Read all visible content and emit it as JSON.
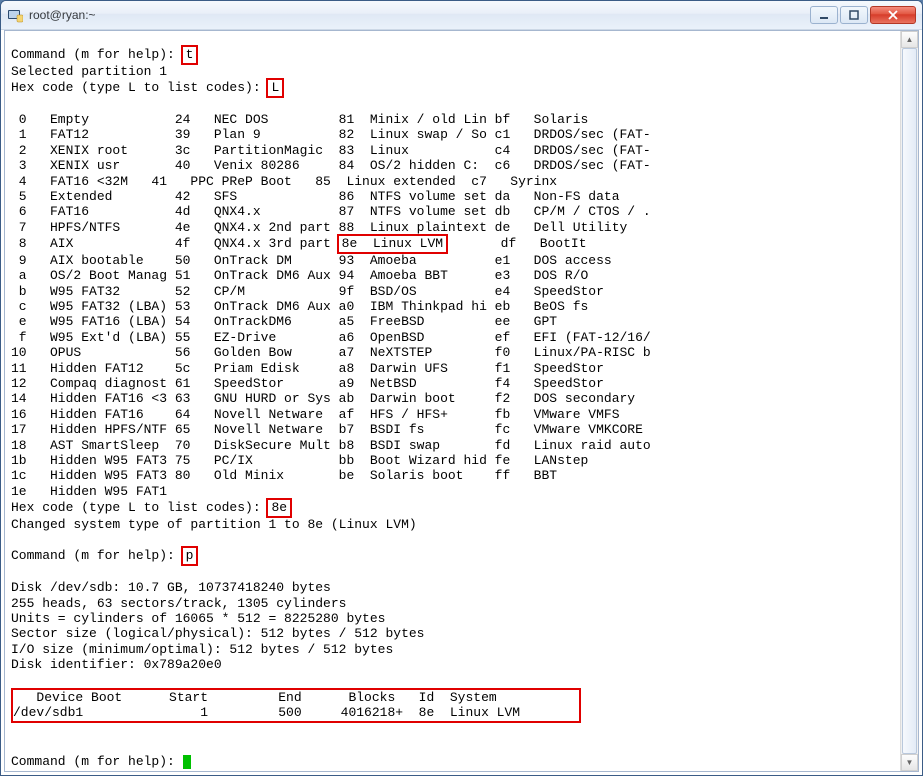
{
  "window": {
    "title": "root@ryan:~"
  },
  "prompts": {
    "cmd_prompt": "Command (m for help): ",
    "hex_prompt": "Hex code (type L to list codes): ",
    "selected_partition": "Selected partition 1",
    "changed_line": "Changed system type of partition 1 to 8e (Linux LVM)"
  },
  "inputs": {
    "t": "t",
    "L": "L",
    "eightE": "8e",
    "p": "p"
  },
  "partition_types": [
    [
      " 0",
      "Empty",
      "24",
      "NEC DOS",
      "81",
      "Minix / old Lin",
      "bf",
      "Solaris"
    ],
    [
      " 1",
      "FAT12",
      "39",
      "Plan 9",
      "82",
      "Linux swap / So",
      "c1",
      "DRDOS/sec (FAT-"
    ],
    [
      " 2",
      "XENIX root",
      "3c",
      "PartitionMagic",
      "83",
      "Linux",
      "c4",
      "DRDOS/sec (FAT-"
    ],
    [
      " 3",
      "XENIX usr",
      "40",
      "Venix 80286",
      "84",
      "OS/2 hidden C:",
      "c6",
      "DRDOS/sec (FAT-"
    ],
    [
      " 4",
      "FAT16 <32M",
      "41",
      "PPC PReP Boot",
      "85",
      "Linux extended",
      "c7",
      "Syrinx"
    ],
    [
      " 5",
      "Extended",
      "42",
      "SFS",
      "86",
      "NTFS volume set",
      "da",
      "Non-FS data"
    ],
    [
      " 6",
      "FAT16",
      "4d",
      "QNX4.x",
      "87",
      "NTFS volume set",
      "db",
      "CP/M / CTOS / ."
    ],
    [
      " 7",
      "HPFS/NTFS",
      "4e",
      "QNX4.x 2nd part",
      "88",
      "Linux plaintext",
      "de",
      "Dell Utility"
    ],
    [
      " 8",
      "AIX",
      "4f",
      "QNX4.x 3rd part",
      "8e",
      "Linux LVM",
      "df",
      "BootIt"
    ],
    [
      " 9",
      "AIX bootable",
      "50",
      "OnTrack DM",
      "93",
      "Amoeba",
      "e1",
      "DOS access"
    ],
    [
      " a",
      "OS/2 Boot Manag",
      "51",
      "OnTrack DM6 Aux",
      "94",
      "Amoeba BBT",
      "e3",
      "DOS R/O"
    ],
    [
      " b",
      "W95 FAT32",
      "52",
      "CP/M",
      "9f",
      "BSD/OS",
      "e4",
      "SpeedStor"
    ],
    [
      " c",
      "W95 FAT32 (LBA)",
      "53",
      "OnTrack DM6 Aux",
      "a0",
      "IBM Thinkpad hi",
      "eb",
      "BeOS fs"
    ],
    [
      " e",
      "W95 FAT16 (LBA)",
      "54",
      "OnTrackDM6",
      "a5",
      "FreeBSD",
      "ee",
      "GPT"
    ],
    [
      " f",
      "W95 Ext'd (LBA)",
      "55",
      "EZ-Drive",
      "a6",
      "OpenBSD",
      "ef",
      "EFI (FAT-12/16/"
    ],
    [
      "10",
      "OPUS",
      "56",
      "Golden Bow",
      "a7",
      "NeXTSTEP",
      "f0",
      "Linux/PA-RISC b"
    ],
    [
      "11",
      "Hidden FAT12",
      "5c",
      "Priam Edisk",
      "a8",
      "Darwin UFS",
      "f1",
      "SpeedStor"
    ],
    [
      "12",
      "Compaq diagnost",
      "61",
      "SpeedStor",
      "a9",
      "NetBSD",
      "f4",
      "SpeedStor"
    ],
    [
      "14",
      "Hidden FAT16 <3",
      "63",
      "GNU HURD or Sys",
      "ab",
      "Darwin boot",
      "f2",
      "DOS secondary"
    ],
    [
      "16",
      "Hidden FAT16",
      "64",
      "Novell Netware",
      "af",
      "HFS / HFS+",
      "fb",
      "VMware VMFS"
    ],
    [
      "17",
      "Hidden HPFS/NTF",
      "65",
      "Novell Netware",
      "b7",
      "BSDI fs",
      "fc",
      "VMware VMKCORE"
    ],
    [
      "18",
      "AST SmartSleep",
      "70",
      "DiskSecure Mult",
      "b8",
      "BSDI swap",
      "fd",
      "Linux raid auto"
    ],
    [
      "1b",
      "Hidden W95 FAT3",
      "75",
      "PC/IX",
      "bb",
      "Boot Wizard hid",
      "fe",
      "LANstep"
    ],
    [
      "1c",
      "Hidden W95 FAT3",
      "80",
      "Old Minix",
      "be",
      "Solaris boot",
      "ff",
      "BBT"
    ],
    [
      "1e",
      "Hidden W95 FAT1",
      "",
      "",
      "",
      "",
      "",
      ""
    ]
  ],
  "disk_info": [
    "Disk /dev/sdb: 10.7 GB, 10737418240 bytes",
    "255 heads, 63 sectors/track, 1305 cylinders",
    "Units = cylinders of 16065 * 512 = 8225280 bytes",
    "Sector size (logical/physical): 512 bytes / 512 bytes",
    "I/O size (minimum/optimal): 512 bytes / 512 bytes",
    "Disk identifier: 0x789a20e0"
  ],
  "table": {
    "header": "   Device Boot      Start         End      Blocks   Id  System",
    "row": "/dev/sdb1               1         500     4016218+  8e  Linux LVM"
  }
}
